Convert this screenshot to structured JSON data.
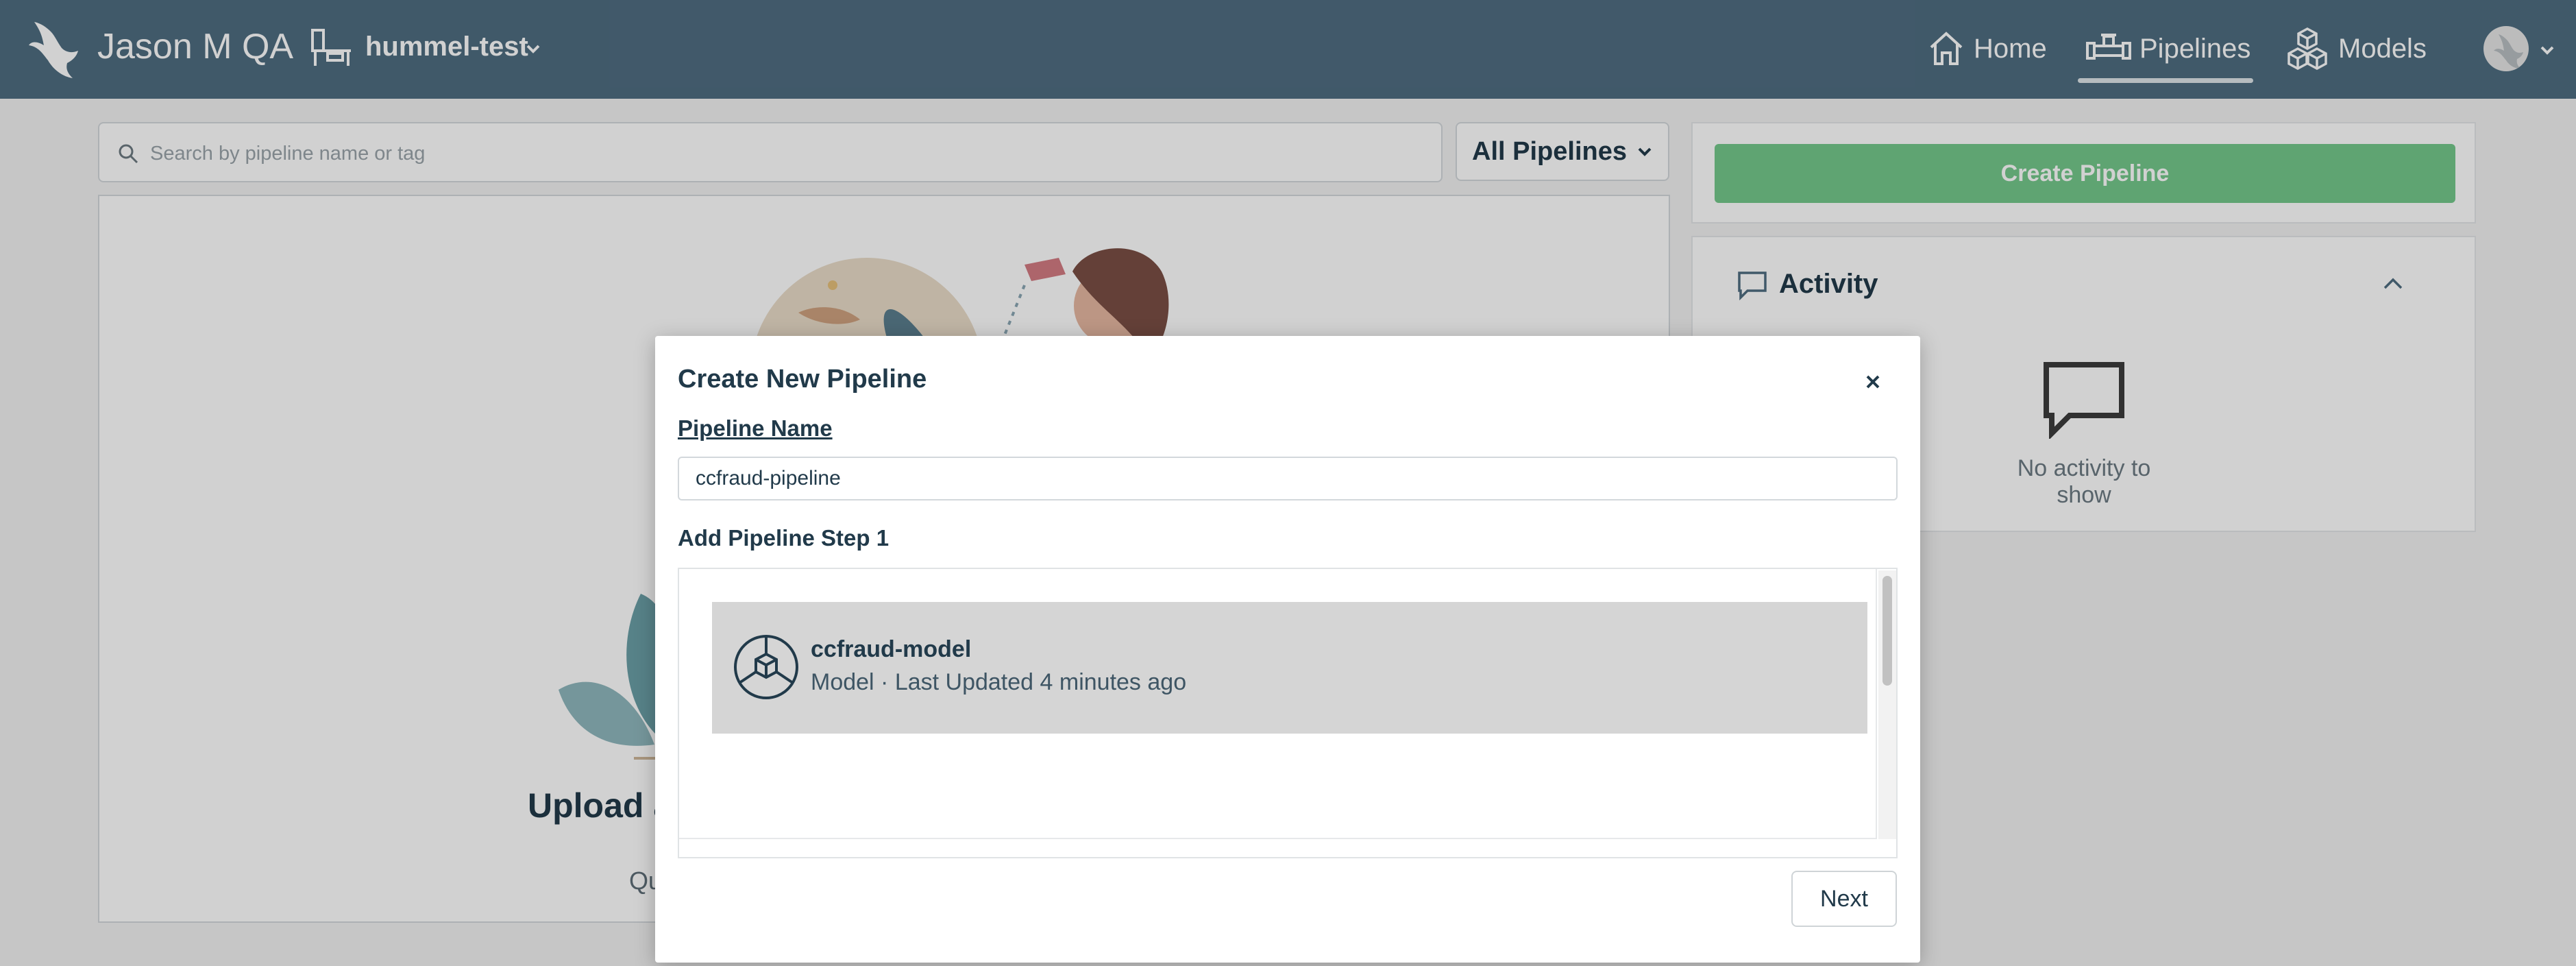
{
  "topbar": {
    "brand": "Jason M QA",
    "workspace": "hummel-test",
    "nav": [
      {
        "label": "Home",
        "icon": "home-icon"
      },
      {
        "label": "Pipelines",
        "icon": "pipeline-icon",
        "active": true
      },
      {
        "label": "Models",
        "icon": "models-icon"
      }
    ],
    "background_color": "#4f6d81"
  },
  "search": {
    "placeholder": "Search by pipeline name or tag",
    "value": ""
  },
  "filter": {
    "label": "All Pipelines"
  },
  "empty_state": {
    "title": "Upload a",
    "subtitle": "Qu"
  },
  "sidebar": {
    "create_button": "Create Pipeline",
    "create_button_color": "#74c88b",
    "activity": {
      "title": "Activity",
      "empty_text": "No activity to show"
    }
  },
  "modal": {
    "title": "Create New Pipeline",
    "name_label": "Pipeline Name",
    "name_value": "ccfraud-pipeline",
    "step_label": "Add Pipeline Step 1",
    "steps": [
      {
        "name": "ccfraud-model",
        "meta": "Model · Last Updated 4 minutes ago"
      }
    ],
    "next_label": "Next"
  }
}
